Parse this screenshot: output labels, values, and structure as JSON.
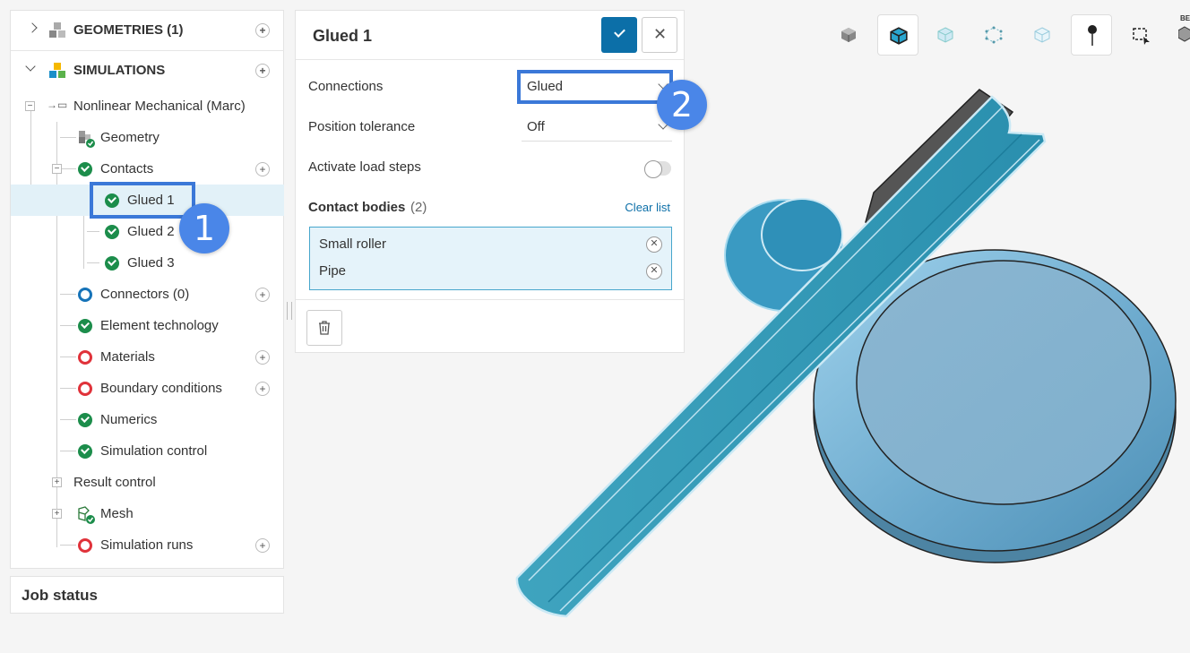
{
  "tree": {
    "geometries": {
      "label": "GEOMETRIES (1)"
    },
    "simulations": {
      "label": "SIMULATIONS"
    },
    "nonlinear": {
      "label": "Nonlinear Mechanical (Marc)"
    },
    "items": {
      "geometry": "Geometry",
      "contacts": "Contacts",
      "glued1": "Glued 1",
      "glued2": "Glued 2",
      "glued3": "Glued 3",
      "connectors": "Connectors (0)",
      "element_technology": "Element technology",
      "materials": "Materials",
      "boundary_conditions": "Boundary conditions",
      "numerics": "Numerics",
      "simulation_control": "Simulation control",
      "result_control": "Result control",
      "mesh": "Mesh",
      "simulation_runs": "Simulation runs"
    }
  },
  "job_status": {
    "label": "Job status"
  },
  "panel": {
    "title": "Glued 1",
    "connections": {
      "label": "Connections",
      "value": "Glued"
    },
    "position_tolerance": {
      "label": "Position tolerance",
      "value": "Off"
    },
    "activate_load_steps": {
      "label": "Activate load steps",
      "on": false
    },
    "contact_bodies": {
      "label": "Contact bodies",
      "count": "(2)",
      "clear_label": "Clear list",
      "items": [
        "Small roller",
        "Pipe"
      ]
    }
  },
  "callouts": [
    "1",
    "2"
  ],
  "toolbar": {
    "badge": "BE"
  },
  "colors": {
    "accent": "#0c6fa8",
    "ok": "#1c8d4b",
    "error": "#e0323a",
    "info": "#1673b8",
    "highlight": "#3b78d8",
    "callout": "#4a86e8"
  }
}
